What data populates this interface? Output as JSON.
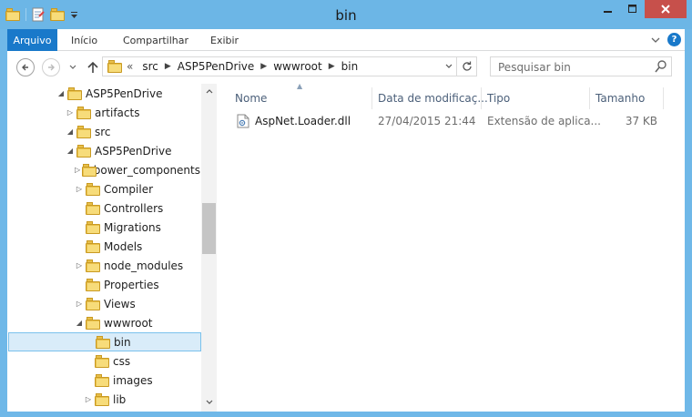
{
  "window": {
    "title": "bin"
  },
  "icons": {
    "qat": [
      "folder-icon",
      "properties-icon",
      "new-folder-icon",
      "customize-qat-icon"
    ],
    "caption": [
      "minimize-icon",
      "maximize-icon",
      "close-icon"
    ]
  },
  "colors": {
    "accent": "#1979ca",
    "titlebar": "#6cb6e6",
    "close": "#c7504b",
    "selection": "#d9ecf9"
  },
  "ribbon": {
    "file_tab": "Arquivo",
    "tabs": [
      "Início",
      "Compartilhar",
      "Exibir"
    ]
  },
  "nav": {
    "recent_glyph": "«",
    "breadcrumbs": [
      "src",
      "ASP5PenDrive",
      "wwwroot",
      "bin"
    ],
    "search_placeholder": "Pesquisar bin"
  },
  "tree": [
    {
      "label": "ASP5PenDrive",
      "arrow": "◢",
      "level": 0
    },
    {
      "label": "artifacts",
      "arrow": "▷",
      "level": 1
    },
    {
      "label": "src",
      "arrow": "◢",
      "level": 1
    },
    {
      "label": "ASP5PenDrive",
      "arrow": "◢",
      "level": 2
    },
    {
      "label": "bower_components",
      "arrow": "▷",
      "level": 3
    },
    {
      "label": "Compiler",
      "arrow": "▷",
      "level": 3
    },
    {
      "label": "Controllers",
      "arrow": "",
      "level": 3
    },
    {
      "label": "Migrations",
      "arrow": "",
      "level": 3
    },
    {
      "label": "Models",
      "arrow": "",
      "level": 3
    },
    {
      "label": "node_modules",
      "arrow": "▷",
      "level": 3
    },
    {
      "label": "Properties",
      "arrow": "",
      "level": 3
    },
    {
      "label": "Views",
      "arrow": "▷",
      "level": 3
    },
    {
      "label": "wwwroot",
      "arrow": "◢",
      "level": 3
    },
    {
      "label": "bin",
      "arrow": "",
      "level": 4,
      "selected": true
    },
    {
      "label": "css",
      "arrow": "",
      "level": 4
    },
    {
      "label": "images",
      "arrow": "",
      "level": 4
    },
    {
      "label": "lib",
      "arrow": "▷",
      "level": 4
    }
  ],
  "columns": [
    "Nome",
    "Data de modificaç...",
    "Tipo",
    "Tamanho"
  ],
  "files": [
    {
      "name": "AspNet.Loader.dll",
      "modified": "27/04/2015 21:44",
      "type": "Extensão de aplica...",
      "size": "37 KB",
      "icon": "dll-file-icon"
    }
  ]
}
